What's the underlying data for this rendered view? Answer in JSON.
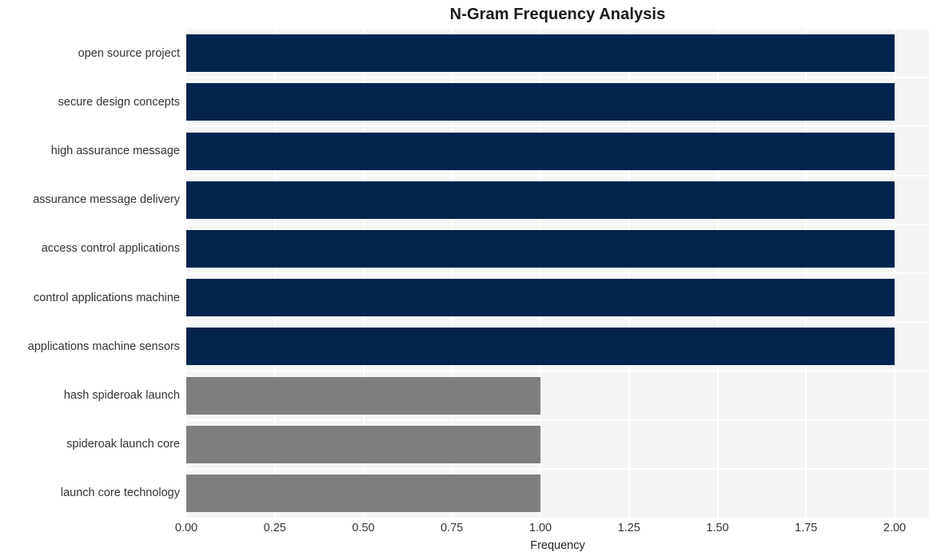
{
  "chart_data": {
    "type": "bar",
    "orientation": "horizontal",
    "title": "N-Gram Frequency Analysis",
    "xlabel": "Frequency",
    "ylabel": "",
    "xlim": [
      0,
      2
    ],
    "xticks": [
      "0.00",
      "0.25",
      "0.50",
      "0.75",
      "1.00",
      "1.25",
      "1.50",
      "1.75",
      "2.00"
    ],
    "xtick_values": [
      0,
      0.25,
      0.5,
      0.75,
      1.0,
      1.25,
      1.5,
      1.75,
      2.0
    ],
    "grid": true,
    "legend": "none",
    "categories": [
      "open source project",
      "secure design concepts",
      "high assurance message",
      "assurance message delivery",
      "access control applications",
      "control applications machine",
      "applications machine sensors",
      "hash spideroak launch",
      "spideroak launch core",
      "launch core technology"
    ],
    "values": [
      2,
      2,
      2,
      2,
      2,
      2,
      2,
      1,
      1,
      1
    ],
    "bar_colors": [
      "#02244e",
      "#02244e",
      "#02244e",
      "#02244e",
      "#02244e",
      "#02244e",
      "#02244e",
      "#7f7e7c",
      "#7f7e7c",
      "#7f7e7c"
    ]
  },
  "style": {
    "plot_background": "#f5f5f5",
    "grid_color": "#ffffff",
    "figure_background": "#ffffff",
    "text_color": "#333333",
    "title_color": "#1a1a1a",
    "accent_primary": "#02244e",
    "accent_secondary": "#7f7e7c"
  }
}
